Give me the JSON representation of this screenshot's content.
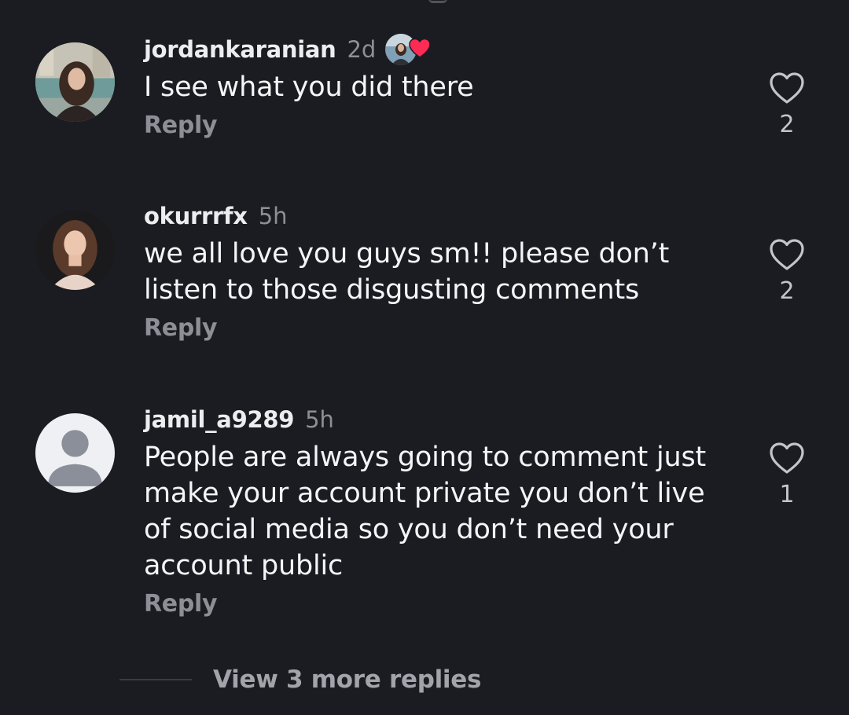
{
  "comments": [
    {
      "username": "jordankaranian",
      "time": "2d",
      "text": "I see what you did there",
      "reply_label": "Reply",
      "likes": "2",
      "liked_by_creator": true,
      "avatar": "photo"
    },
    {
      "username": "okurrrfx",
      "time": "5h",
      "text": "we all love you guys sm!! please don’t listen to those disgusting comments",
      "reply_label": "Reply",
      "likes": "2",
      "liked_by_creator": false,
      "avatar": "photo"
    },
    {
      "username": "jamil_a9289",
      "time": "5h",
      "text": "People are always going to comment just make your account private you don’t live of social media so you don’t need your account public",
      "reply_label": "Reply",
      "likes": "1",
      "liked_by_creator": false,
      "avatar": "default"
    }
  ],
  "more_replies_label": "View 3 more replies",
  "colors": {
    "background": "#1b1c21",
    "username": "#ededf0",
    "muted": "#8e8f96",
    "text": "#f5f5f7",
    "heart_badge": "#fe2c55",
    "default_avatar_bg": "#eef0f4",
    "default_avatar_fg": "#8b8f99"
  },
  "icons": {
    "like": "heart-outline-icon",
    "creator_like": "heart-filled-icon"
  }
}
